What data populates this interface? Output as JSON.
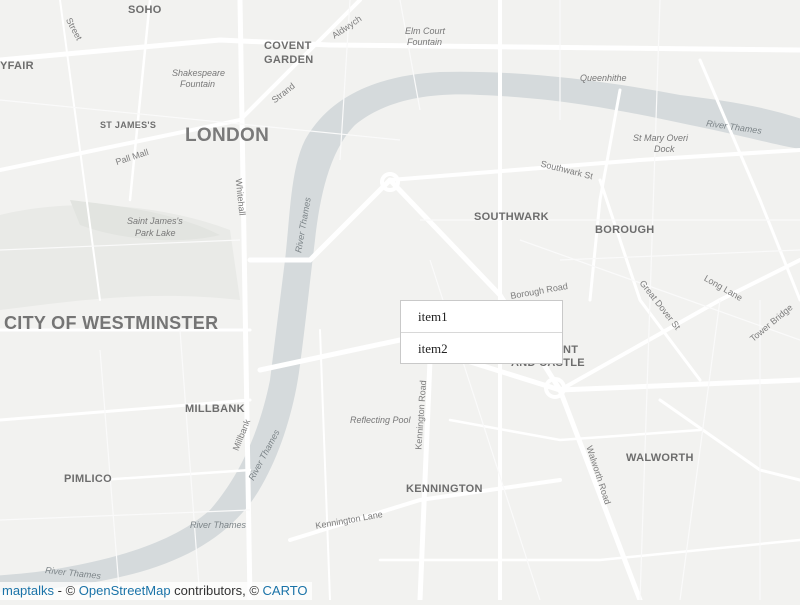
{
  "map": {
    "labels": {
      "soho": "SOHO",
      "covent_garden_1": "COVENT",
      "covent_garden_2": "GARDEN",
      "mayfair": "YFAIR",
      "st_james": "ST JAMES'S",
      "london": "LONDON",
      "shakespeare_1": "Shakespeare",
      "shakespeare_2": "Fountain",
      "elm_court_1": "Elm Court",
      "elm_court_2": "Fountain",
      "queenhithe": "Queenhithe",
      "st_mary_1": "St Mary Overi",
      "st_mary_2": "Dock",
      "river_thames_ne": "River Thames",
      "southwark_st": "Southwark St",
      "southwark": "SOUTHWARK",
      "borough": "BOROUGH",
      "saint_james_park_1": "Saint James's",
      "saint_james_park_2": "Park Lake",
      "river_thames_w": "River Thames",
      "whitehall": "Whitehall",
      "pall_mall": "Pall Mall",
      "strand": "Strand",
      "aldwych": "Aldwych",
      "bedford_st": "Street",
      "city_of_westminster": "CITY OF WESTMINSTER",
      "borough_road": "Borough Road",
      "great_dover": "Great Dover St",
      "long_lane": "Long Lane",
      "tower_bridge": "Tower Bridge",
      "elephant_1": "NT",
      "elephant_2": "AND CASTLE",
      "millbank_area": "MILLBANK",
      "millbank_road": "Millbank",
      "reflecting_pool": "Reflecting Pool",
      "kennington_road": "Kennington Road",
      "walworth_road": "Walworth Road",
      "walworth": "WALWORTH",
      "river_thames_sw": "River Thames",
      "pimlico": "PIMLICO",
      "kennington": "KENNINGTON",
      "kennington_lane": "Kennington Lane",
      "river_thames_s": "River Thames",
      "river_thames_bottom": "River Thames"
    }
  },
  "context_menu": {
    "items": [
      "item1",
      "item2"
    ]
  },
  "attribution": {
    "maptalks": "maptalks",
    "sep": " - © ",
    "osm": "OpenStreetMap",
    "contrib": " contributors, © ",
    "carto": "CARTO"
  },
  "colors": {
    "land": "#f2f2f0",
    "water": "#d5dadc",
    "road": "#ffffff",
    "park": "#e6e8e4"
  }
}
